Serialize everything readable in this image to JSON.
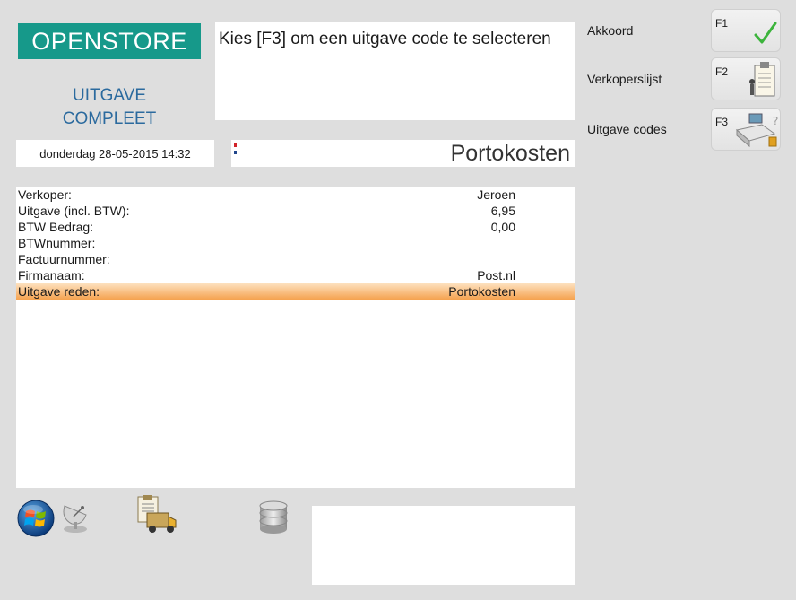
{
  "header": {
    "logo": "OPENSTORE",
    "mode_line1": "UITGAVE",
    "mode_line2": "COMPLEET",
    "message": "Kies [F3] om een uitgave code te selecteren",
    "datetime": "donderdag 28-05-2015 14:32",
    "title": "Portokosten"
  },
  "details": {
    "rows": [
      {
        "label": "Verkoper:",
        "value": "Jeroen"
      },
      {
        "label": "Uitgave (incl. BTW):",
        "value": "6,95"
      },
      {
        "label": "BTW Bedrag:",
        "value": "0,00"
      },
      {
        "label": "BTWnummer:",
        "value": ""
      },
      {
        "label": "Factuurnummer:",
        "value": ""
      },
      {
        "label": "Firmanaam:",
        "value": "Post.nl"
      },
      {
        "label": "Uitgave reden:",
        "value": "Portokosten",
        "selected": true
      }
    ]
  },
  "functions": [
    {
      "label": "Akkoord",
      "key": "F1",
      "icon": "checkmark-icon"
    },
    {
      "label": "Verkoperslijst",
      "key": "F2",
      "icon": "clipboard-list-icon"
    },
    {
      "label": "Uitgave codes",
      "key": "F3",
      "icon": "cash-register-icon"
    }
  ],
  "bottom_icons": [
    "windows-logo-icon",
    "satellite-dish-icon",
    "delivery-truck-icon",
    "database-icon"
  ],
  "colors": {
    "logo_bg": "#16998a",
    "mode_text": "#2b6a9e",
    "selected_row": "#f5a24f",
    "background": "#dedede"
  }
}
